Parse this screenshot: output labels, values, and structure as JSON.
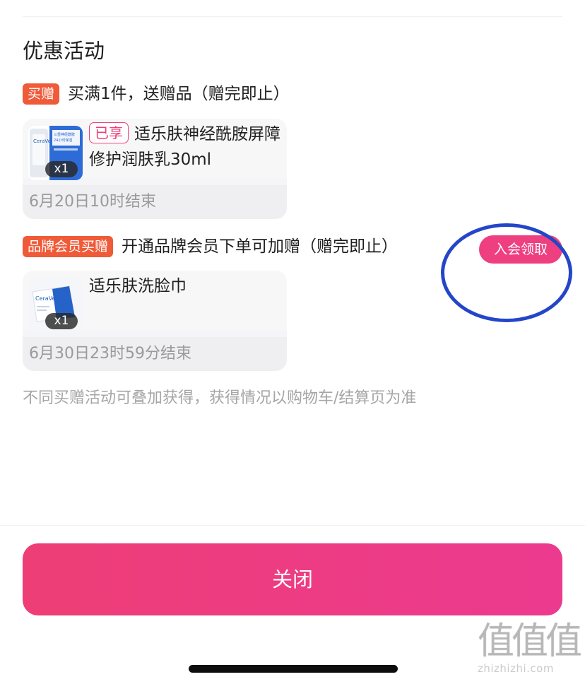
{
  "sheet": {
    "section_title": "优惠活动",
    "promotions": [
      {
        "tag": "买赠",
        "description": "买满1件，送赠品（赠完即止）",
        "gift": {
          "status_badge": "已享",
          "name": "适乐肤神经酰胺屏障修护润肤乳30ml",
          "quantity": "x1",
          "end_time": "6月20日10时结束",
          "thumb_icon": "product-bottle-icon",
          "thumb_brand_text": "CeraVe",
          "thumb_label_text": "三重神经酰胺 24小时保湿"
        }
      },
      {
        "tag": "品牌会员买赠",
        "description": "开通品牌会员下单可加赠（赠完即止）",
        "action_label": "入会领取",
        "gift": {
          "name": "适乐肤洗脸巾",
          "quantity": "x1",
          "end_time": "6月30日23时59分结束",
          "thumb_icon": "product-tissue-pack-icon",
          "thumb_brand_text": "CeraVe"
        }
      }
    ],
    "stack_note": "不同买赠活动可叠加获得，获得情况以购物车/结算页为准",
    "close_label": "关闭"
  },
  "watermark": {
    "logo_text": "值值值",
    "url": "zhizhizhi.com"
  },
  "colors": {
    "promo_tag": "#ef5a38",
    "accent_pink": "#ee3f80",
    "close_gradient_start": "#ee3e76",
    "close_gradient_end": "#ec3a8f",
    "annotation_ring": "#2346c9",
    "muted_text": "#9a9a9a"
  }
}
